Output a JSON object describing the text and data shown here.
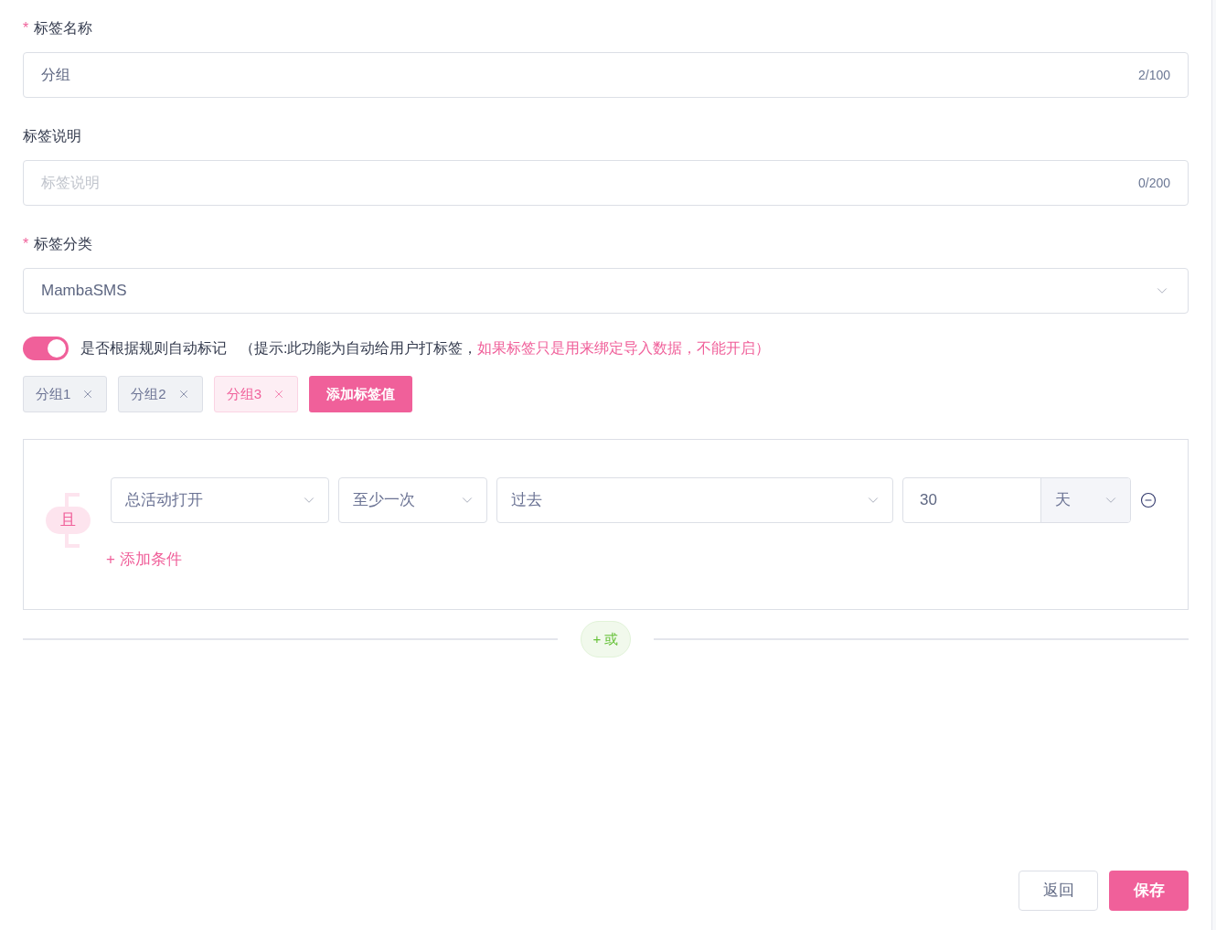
{
  "fields": [
    {
      "kind": "input",
      "label": "标签名称",
      "required_mark": "*",
      "value": "分组",
      "counter": "2/100"
    },
    {
      "kind": "input",
      "label": "标签说明",
      "placeholder": "标签说明",
      "counter": "0/200"
    },
    {
      "kind": "select",
      "label": "标签分类",
      "required_mark": "*",
      "value": "MambaSMS"
    }
  ],
  "auto_tag": {
    "on": true,
    "label": "是否根据规则自动标记",
    "hint": "（提示:此功能为自动给用户打标签，",
    "warning": "如果标签只是用来绑定导入数据，不能开启）"
  },
  "tag_values": [
    {
      "label": "分组1",
      "selected": false
    },
    {
      "label": "分组2",
      "selected": false
    },
    {
      "label": "分组3",
      "selected": true
    }
  ],
  "add_tag_value_button": "添加标签值",
  "rule_group": {
    "logic": "且",
    "conditions": [
      {
        "event": "总活动打开",
        "frequency": "至少一次",
        "time_range": "过去",
        "amount": "30",
        "unit": "天"
      }
    ],
    "add_condition": "+ 添加条件"
  },
  "or_button": "+ 或",
  "buttons": {
    "back": "返回",
    "save": "保存"
  }
}
